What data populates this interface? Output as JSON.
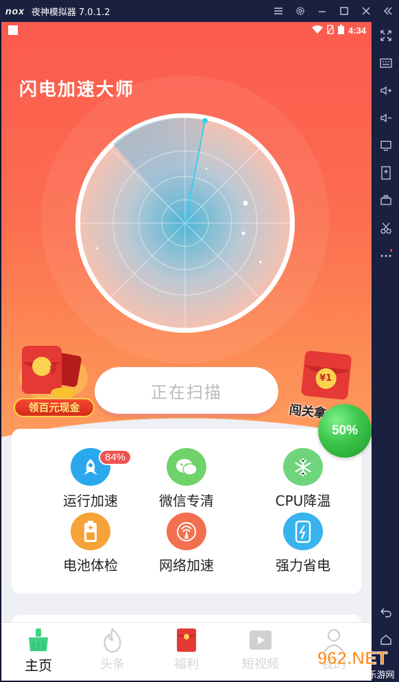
{
  "emulator": {
    "logo": "nox",
    "title": "夜神模拟器 7.0.1.2",
    "controls": [
      "menu-icon",
      "settings-icon",
      "minimize-icon",
      "maximize-icon",
      "close-icon",
      "collapse-icon"
    ],
    "sidebar_icons": [
      "fullscreen-icon",
      "keyboard-icon",
      "volume-up-icon",
      "volume-down-icon",
      "screen-icon",
      "apk-install-icon",
      "multi-instance-icon",
      "scissors-icon",
      "more-icon",
      "back-icon",
      "home-icon"
    ]
  },
  "statusbar": {
    "time": "4:34"
  },
  "app": {
    "title": "闪电加速大师",
    "scan_button": "正在扫描",
    "left_promo": {
      "currency": "¥",
      "label": "领百元现金"
    },
    "right_promo": {
      "amount": "¥1",
      "label": "闯关拿"
    },
    "float_ball": "50%"
  },
  "tools": [
    {
      "label": "运行加速",
      "icon": "rocket-icon",
      "color": "#2aa8ec",
      "badge": "84%"
    },
    {
      "label": "微信专清",
      "icon": "wechat-icon",
      "color": "#6fd36a"
    },
    {
      "label": "CPU降温",
      "icon": "snowflake-icon",
      "color": "#6fd57c"
    },
    {
      "label": "电池体检",
      "icon": "battery-icon",
      "color": "#f5a338"
    },
    {
      "label": "网络加速",
      "icon": "network-icon",
      "color": "#f26f4f"
    },
    {
      "label": "强力省电",
      "icon": "power-save-icon",
      "color": "#37b3ee"
    }
  ],
  "nav": [
    {
      "label": "主页",
      "icon": "broom-icon",
      "active": true
    },
    {
      "label": "头条",
      "icon": "flame-icon"
    },
    {
      "label": "福利",
      "icon": "red-packet-icon"
    },
    {
      "label": "短视频",
      "icon": "video-icon"
    },
    {
      "label": "我的",
      "icon": "user-icon"
    }
  ],
  "watermark": {
    "brand": "962.NET",
    "sub": "乐游网"
  },
  "colors": {
    "hero_top": "#fb5a4e",
    "hero_bottom": "#fea060",
    "accent_green": "#3bc54a"
  }
}
